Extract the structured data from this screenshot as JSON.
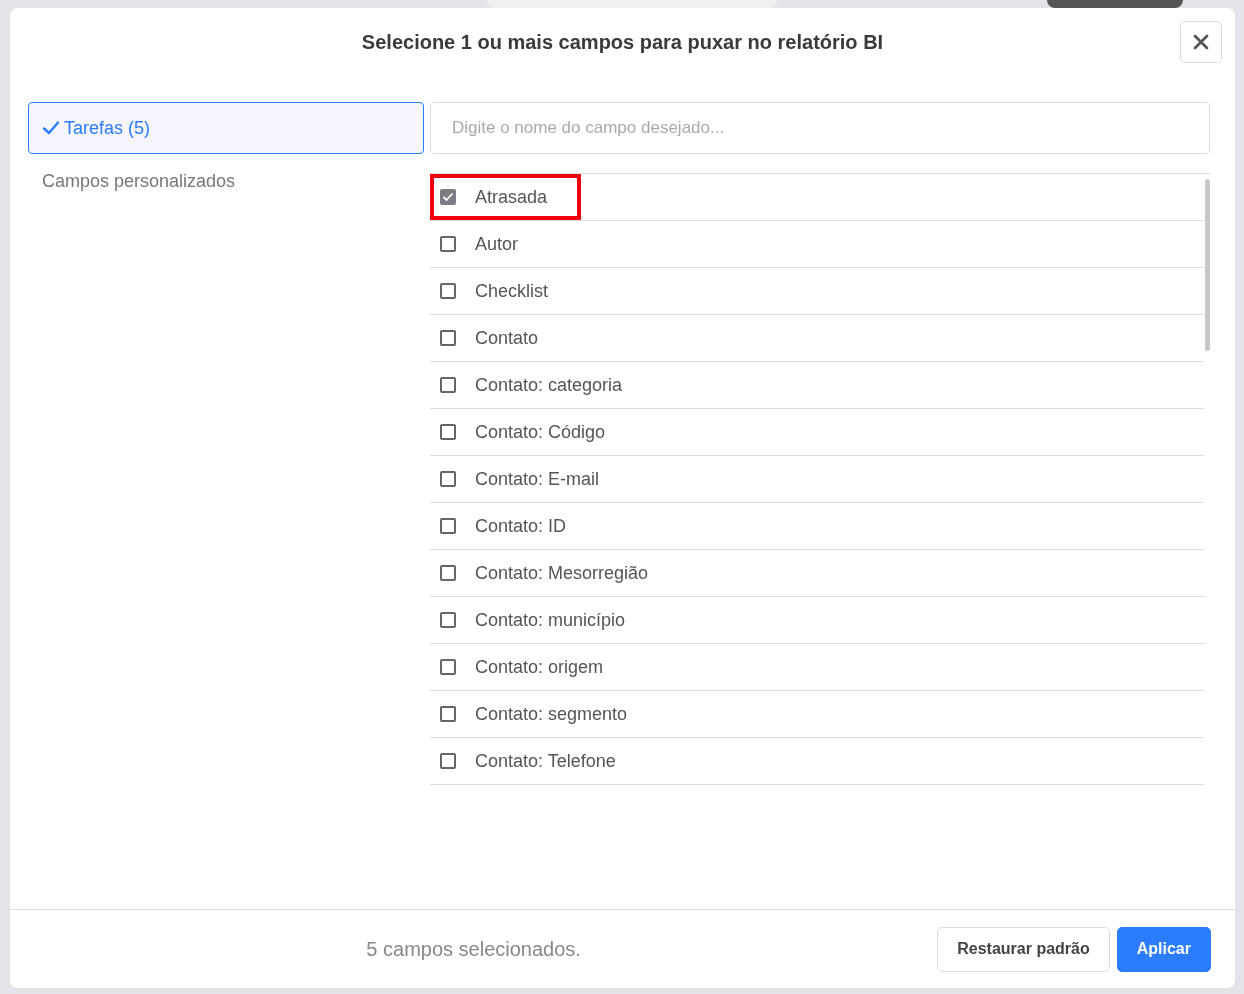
{
  "dialog": {
    "title": "Selecione 1 ou mais campos para puxar no relatório BI"
  },
  "sidebar": {
    "items": [
      {
        "label": "Tarefas (5)",
        "selected": true
      },
      {
        "label": "Campos personalizados",
        "selected": false
      }
    ]
  },
  "search": {
    "placeholder": "Digite o nome do campo desejado..."
  },
  "fields": [
    {
      "label": "Atrasada",
      "checked": true,
      "highlighted": true
    },
    {
      "label": "Autor",
      "checked": false,
      "highlighted": false
    },
    {
      "label": "Checklist",
      "checked": false,
      "highlighted": false
    },
    {
      "label": "Contato",
      "checked": false,
      "highlighted": false
    },
    {
      "label": "Contato: categoria",
      "checked": false,
      "highlighted": false
    },
    {
      "label": "Contato: Código",
      "checked": false,
      "highlighted": false
    },
    {
      "label": "Contato: E-mail",
      "checked": false,
      "highlighted": false
    },
    {
      "label": "Contato: ID",
      "checked": false,
      "highlighted": false
    },
    {
      "label": "Contato: Mesorregião",
      "checked": false,
      "highlighted": false
    },
    {
      "label": "Contato: município",
      "checked": false,
      "highlighted": false
    },
    {
      "label": "Contato: origem",
      "checked": false,
      "highlighted": false
    },
    {
      "label": "Contato: segmento",
      "checked": false,
      "highlighted": false
    },
    {
      "label": "Contato: Telefone",
      "checked": false,
      "highlighted": false
    }
  ],
  "footer": {
    "status": "5 campos selecionados.",
    "buttons": [
      {
        "label": "Restaurar padrão",
        "kind": "secondary"
      },
      {
        "label": "Aplicar",
        "kind": "primary"
      }
    ]
  }
}
